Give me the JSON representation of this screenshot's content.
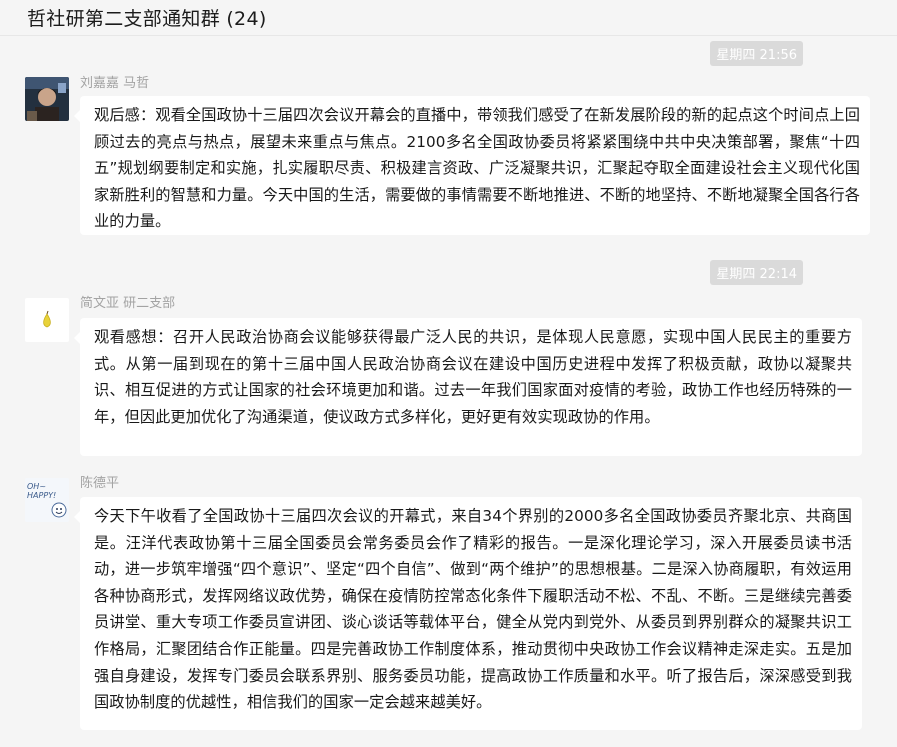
{
  "header": {
    "title": "哲社研第二支部通知群 (24)"
  },
  "messages": [
    {
      "time": "星期四 21:56",
      "sender": "刘嘉嘉 马哲",
      "avatar_icon": "photo-avatar-icon",
      "text": "观后感：观看全国政协十三届四次会议开幕会的直播中，带领我们感受了在新发展阶段的新的起点这个时间点上回顾过去的亮点与热点，展望未来重点与焦点。2100多名全国政协委员将紧紧围绕中共中央决策部署，聚焦“十四五”规划纲要制定和实施，扎实履职尽责、积极建言资政、广泛凝聚共识，汇聚起夺取全面建设社会主义现代化国家新胜利的智慧和力量。今天中国的生活，需要做的事情需要不断地推进、不断的地坚持、不断地凝聚全国各行各业的力量。"
    },
    {
      "time": "星期四 22:14",
      "sender": "简文亚 研二支部",
      "avatar_icon": "pear-avatar-icon",
      "text": "观看感想：召开人民政治协商会议能够获得最广泛人民的共识，是体现人民意愿，实现中国人民民主的重要方式。从第一届到现在的第十三届中国人民政治协商会议在建设中国历史进程中发挥了积极贡献，政协以凝聚共识、相互促进的方式让国家的社会环境更加和谐。过去一年我们国家面对疫情的考验，政协工作也经历特殊的一年，但因此更加优化了沟通渠道，使议政方式多样化，更好更有效实现政协的作用。"
    },
    {
      "sender": "陈德平",
      "avatar_icon": "oh-happy-avatar-icon",
      "avatar_text": "OH~ HAPPY!",
      "text": "今天下午收看了全国政协十三届四次会议的开幕式，来自34个界别的2000多名全国政协委员齐聚北京、共商国是。汪洋代表政协第十三届全国委员会常务委员会作了精彩的报告。一是深化理论学习，深入开展委员读书活动，进一步筑牢增强“四个意识”、坚定“四个自信”、做到“两个维护”的思想根基。二是深入协商履职，有效运用各种协商形式，发挥网络议政优势，确保在疫情防控常态化条件下履职活动不松、不乱、不断。三是继续完善委员讲堂、重大专项工作委员宣讲团、谈心谈话等载体平台，健全从党内到党外、从委员到界别群众的凝聚共识工作格局，汇聚团结合作正能量。四是完善政协工作制度体系，推动贯彻中央政协工作会议精神走深走实。五是加强自身建设，发挥专门委员会联系界别、服务委员功能，提高政协工作质量和水平。听了报告后，深深感受到我国政协制度的优越性，相信我们的国家一定会越来越美好。"
    }
  ],
  "colors": {
    "background": "#f5f5f5",
    "bubble": "#ffffff",
    "time_badge": "#dadada",
    "sender_text": "#a3a3a3"
  }
}
